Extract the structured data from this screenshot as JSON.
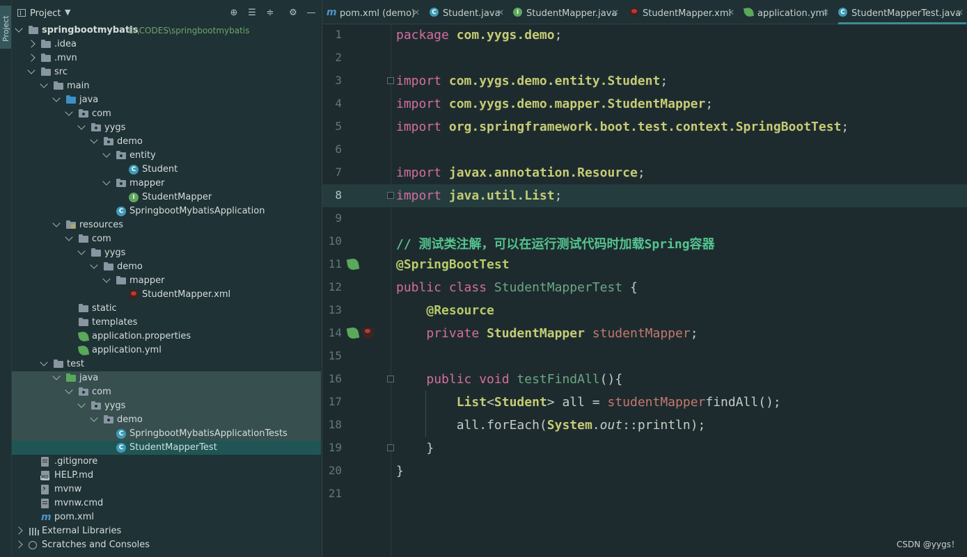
{
  "side_stripe": {
    "label": "Project"
  },
  "project_panel": {
    "title": "Project",
    "tree": [
      {
        "label": "springbootmybatis",
        "path": "E:\\CODES\\springbootmybatis",
        "bold": true,
        "icon": "folder-icon"
      },
      {
        "label": ".idea",
        "icon": "folder-icon"
      },
      {
        "label": ".mvn",
        "icon": "folder-icon"
      },
      {
        "label": "src",
        "icon": "folder-icon"
      },
      {
        "label": "main",
        "icon": "folder-icon"
      },
      {
        "label": "java",
        "icon": "source-folder-icon"
      },
      {
        "label": "com",
        "icon": "package-icon"
      },
      {
        "label": "yygs",
        "icon": "package-icon"
      },
      {
        "label": "demo",
        "icon": "package-icon"
      },
      {
        "label": "entity",
        "icon": "package-icon"
      },
      {
        "label": "Student",
        "icon": "class-icon"
      },
      {
        "label": "mapper",
        "icon": "package-icon"
      },
      {
        "label": "StudentMapper",
        "icon": "interface-icon"
      },
      {
        "label": "SpringbootMybatisApplication",
        "icon": "spring-class-icon"
      },
      {
        "label": "resources",
        "icon": "resources-folder-icon"
      },
      {
        "label": "com",
        "icon": "folder-icon"
      },
      {
        "label": "yygs",
        "icon": "folder-icon"
      },
      {
        "label": "demo",
        "icon": "folder-icon"
      },
      {
        "label": "mapper",
        "icon": "folder-icon"
      },
      {
        "label": "StudentMapper.xml",
        "icon": "mybatis-xml-icon"
      },
      {
        "label": "static",
        "icon": "folder-icon"
      },
      {
        "label": "templates",
        "icon": "folder-icon"
      },
      {
        "label": "application.properties",
        "icon": "spring-config-icon"
      },
      {
        "label": "application.yml",
        "icon": "spring-config-icon"
      },
      {
        "label": "test",
        "icon": "folder-icon"
      },
      {
        "label": "java",
        "icon": "test-folder-icon"
      },
      {
        "label": "com",
        "icon": "package-icon"
      },
      {
        "label": "yygs",
        "icon": "package-icon"
      },
      {
        "label": "demo",
        "icon": "package-icon"
      },
      {
        "label": "SpringbootMybatisApplicationTests",
        "icon": "spring-test-class-icon"
      },
      {
        "label": "StudentMapperTest",
        "icon": "class-icon"
      },
      {
        "label": ".gitignore",
        "icon": "git-file-icon"
      },
      {
        "label": "HELP.md",
        "icon": "markdown-file-icon"
      },
      {
        "label": "mvnw",
        "icon": "script-file-icon"
      },
      {
        "label": "mvnw.cmd",
        "icon": "text-file-icon"
      },
      {
        "label": "pom.xml",
        "icon": "maven-icon"
      },
      {
        "label": "External Libraries",
        "icon": "libraries-icon"
      },
      {
        "label": "Scratches and Consoles",
        "icon": "scratches-icon"
      }
    ]
  },
  "tabs": [
    {
      "label": "pom.xml (demo)",
      "icon": "maven-icon"
    },
    {
      "label": "Student.java",
      "icon": "class-icon"
    },
    {
      "label": "StudentMapper.java",
      "icon": "interface-icon"
    },
    {
      "label": "StudentMapper.xml",
      "icon": "mybatis-xml-icon"
    },
    {
      "label": "application.yml",
      "icon": "spring-config-icon"
    },
    {
      "label": "StudentMapperTest.java",
      "icon": "class-icon",
      "active": true
    }
  ],
  "editor": {
    "line_numbers": [
      "1",
      "2",
      "3",
      "4",
      "5",
      "6",
      "7",
      "8",
      "9",
      "10",
      "11",
      "12",
      "13",
      "14",
      "15",
      "16",
      "17",
      "18",
      "19",
      "20",
      "21"
    ],
    "current_line": "8",
    "code": {
      "l1": {
        "kw": "package",
        "pkg": "com.yygs.demo",
        "semi": ";"
      },
      "l3": {
        "kw": "import",
        "pkg": "com.yygs.demo.entity.",
        "cls": "Student",
        "semi": ";"
      },
      "l4": {
        "kw": "import",
        "pkg": "com.yygs.demo.mapper.",
        "cls": "StudentMapper",
        "semi": ";"
      },
      "l5": {
        "kw": "import",
        "pkg": "org.springframework.boot.test.context.",
        "cls": "SpringBootTest",
        "semi": ";"
      },
      "l7": {
        "kw": "import",
        "pkg": "javax.annotation.",
        "cls": "Resource",
        "semi": ";"
      },
      "l8": {
        "kw": "import",
        "pkg": "java.util.",
        "cls": "List",
        "semi": ";"
      },
      "l10": {
        "comment": "// 测试类注解，可以在运行测试代码时加载Spring容器"
      },
      "l11": {
        "annotation": "@SpringBootTest"
      },
      "l12": {
        "kw": "public class",
        "name": "StudentMapperTest",
        "brace": " {"
      },
      "l13": {
        "annotation": "@Resource"
      },
      "l14": {
        "kw": "private",
        "type": "StudentMapper",
        "field": "studentMapper",
        "semi": ";"
      },
      "l16": {
        "kw": "public void",
        "name": "testFindAll",
        "rest": "(){"
      },
      "l17": {
        "type": "List",
        "lt": "<",
        "generic": "Student",
        "gt": ">",
        "var": " all ",
        "eq": "= ",
        "field": "studentMapper",
        ".": ".",
        "call": "findAll",
        "end": "();"
      },
      "l18": {
        "var": "all",
        "dot": ".",
        "call": "forEach",
        "open": "(",
        "cls": "System",
        "dot2": ".",
        "static": "out",
        "ref": "::",
        "meth": "println",
        "end": ");"
      },
      "l19": {
        "brace": "}"
      },
      "l20": {
        "brace": "}"
      }
    }
  },
  "watermark": "CSDN @yygs！"
}
